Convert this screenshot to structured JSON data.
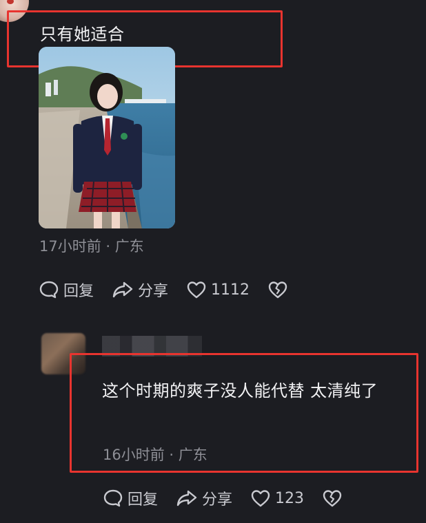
{
  "comment1": {
    "text": "只有她适合",
    "meta": "17小时前 · 广东",
    "actions": {
      "reply": "回复",
      "share": "分享",
      "likes": "1112"
    }
  },
  "comment2": {
    "text": "这个时期的爽子没人能代替 太清纯了",
    "meta": "16小时前 · 广东",
    "actions": {
      "reply": "回复",
      "share": "分享",
      "likes": "123"
    }
  },
  "colors": {
    "background": "#1c1d22",
    "highlight": "#e8342f",
    "meta_text": "#8e8f96"
  },
  "icons": [
    "reply-icon",
    "share-icon",
    "heart-icon",
    "dislike-icon"
  ]
}
